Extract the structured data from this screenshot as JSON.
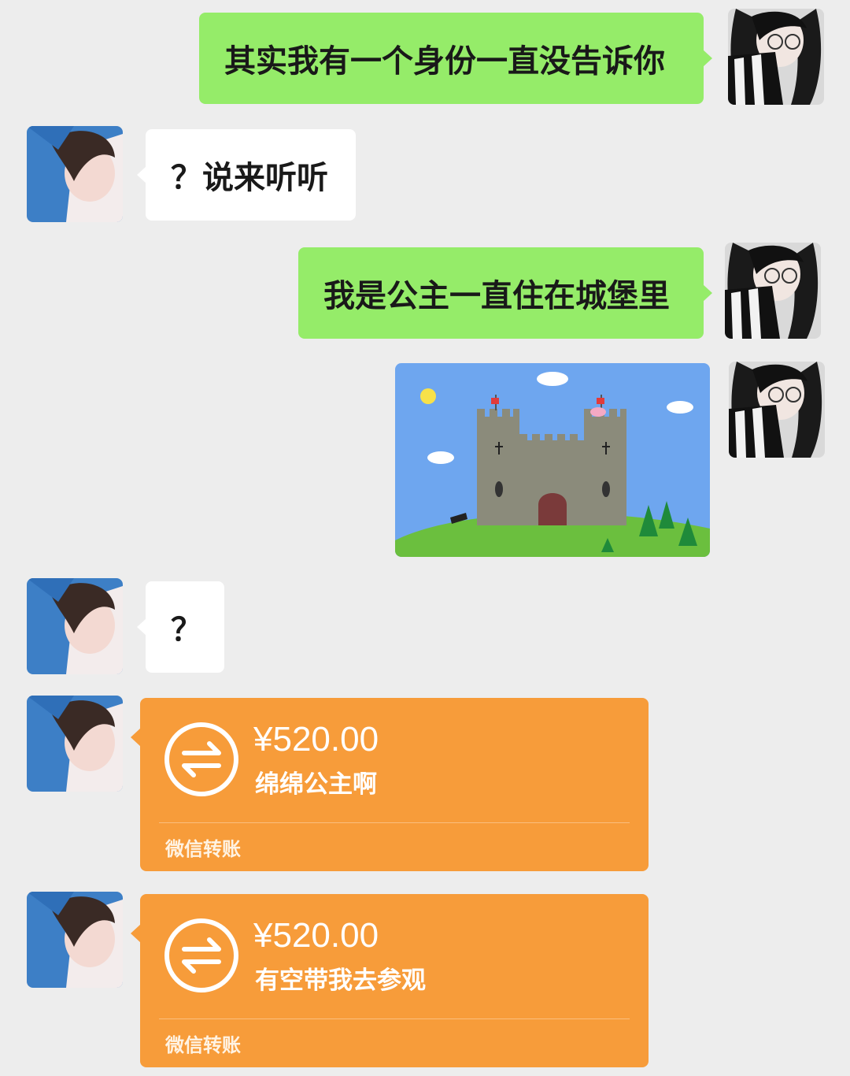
{
  "messages": [
    {
      "sender": "self",
      "type": "text",
      "text": "其实我有一个身份一直没告诉你"
    },
    {
      "sender": "other",
      "type": "text",
      "text": "？说来听听"
    },
    {
      "sender": "self",
      "type": "text",
      "text": "我是公主一直住在城堡里"
    },
    {
      "sender": "self",
      "type": "image",
      "image": "castle-illustration"
    },
    {
      "sender": "other",
      "type": "text",
      "text": "？"
    },
    {
      "sender": "other",
      "type": "transfer",
      "amount": "¥520.00",
      "note": "绵绵公主啊",
      "label": "微信转账"
    },
    {
      "sender": "other",
      "type": "transfer",
      "amount": "¥520.00",
      "note": "有空带我去参观",
      "label": "微信转账"
    }
  ],
  "icons": {
    "transfer": "transfer-arrows-icon"
  },
  "colors": {
    "background": "#ededed",
    "self_bubble": "#95ec69",
    "other_bubble": "#ffffff",
    "transfer_card": "#f79c3a"
  }
}
